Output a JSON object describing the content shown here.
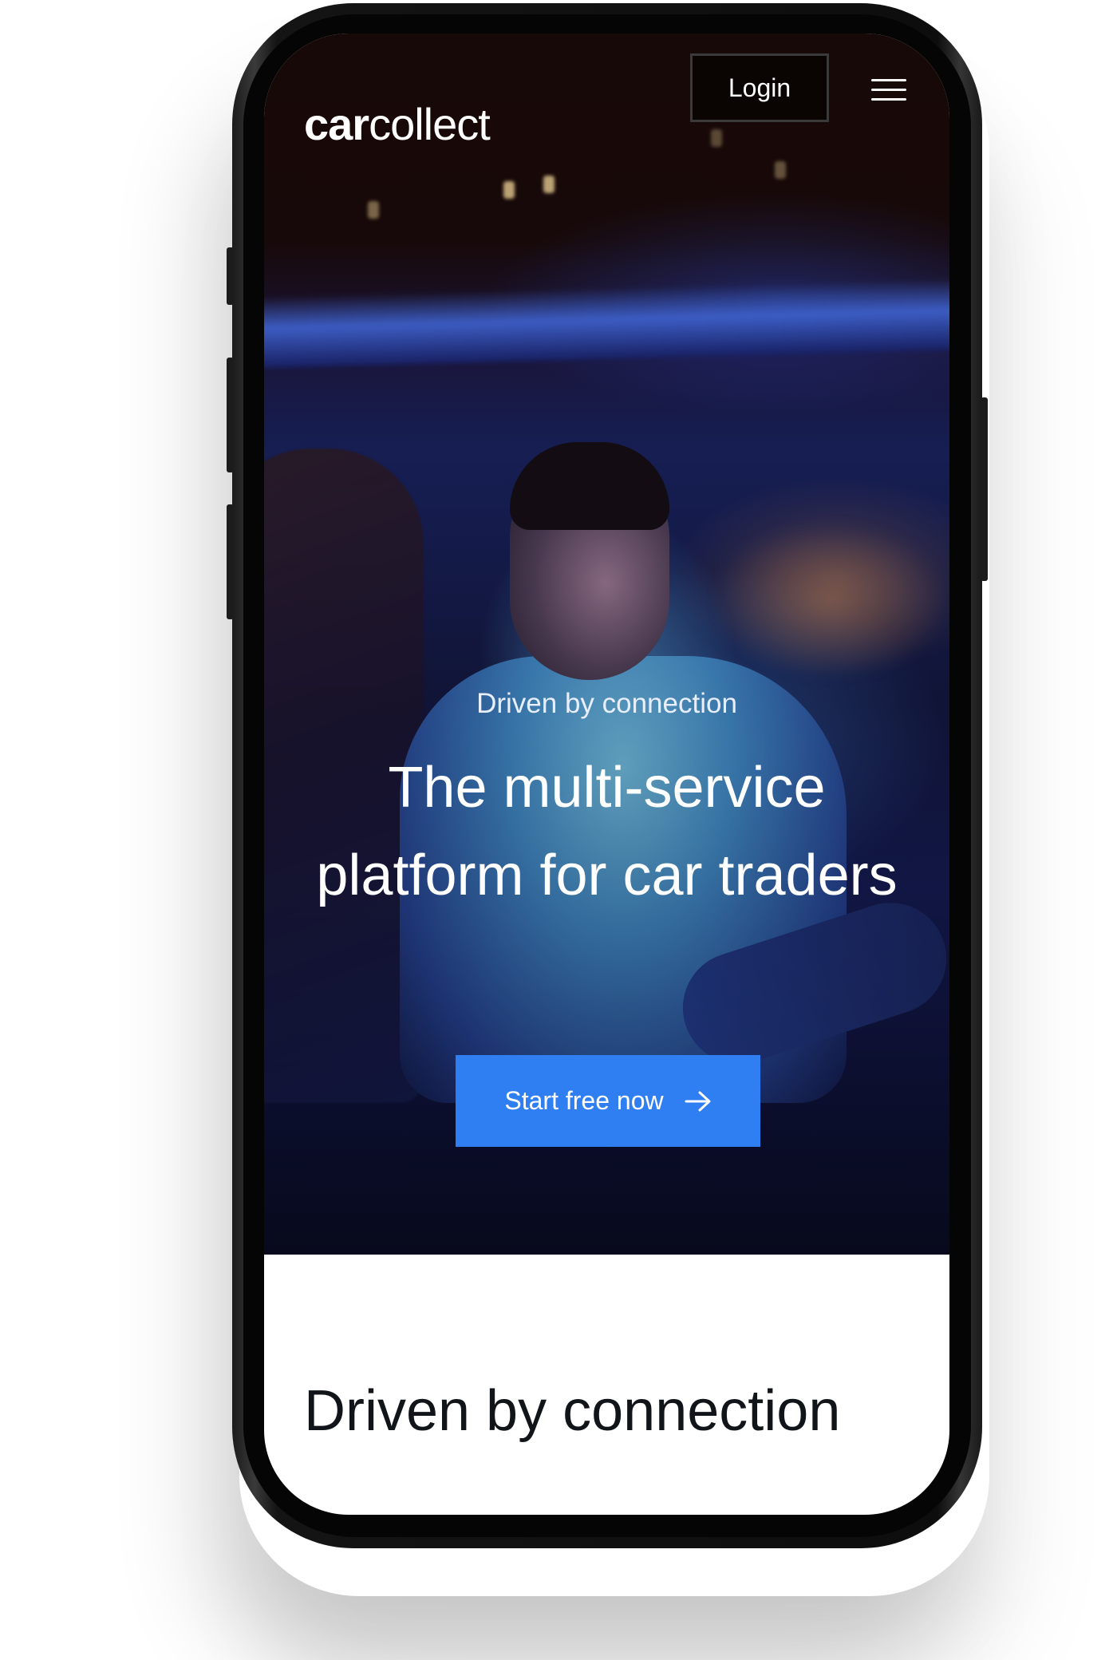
{
  "header": {
    "logo_bold": "car",
    "logo_light": "collect",
    "login_label": "Login",
    "menu_icon": "hamburger-menu-icon"
  },
  "hero": {
    "eyebrow": "Driven by connection",
    "title": "The multi-service platform for car traders",
    "cta_label": "Start free now",
    "cta_icon": "arrow-right-icon",
    "cta_color": "#2f7ef2"
  },
  "section": {
    "title": "Driven by connection"
  }
}
